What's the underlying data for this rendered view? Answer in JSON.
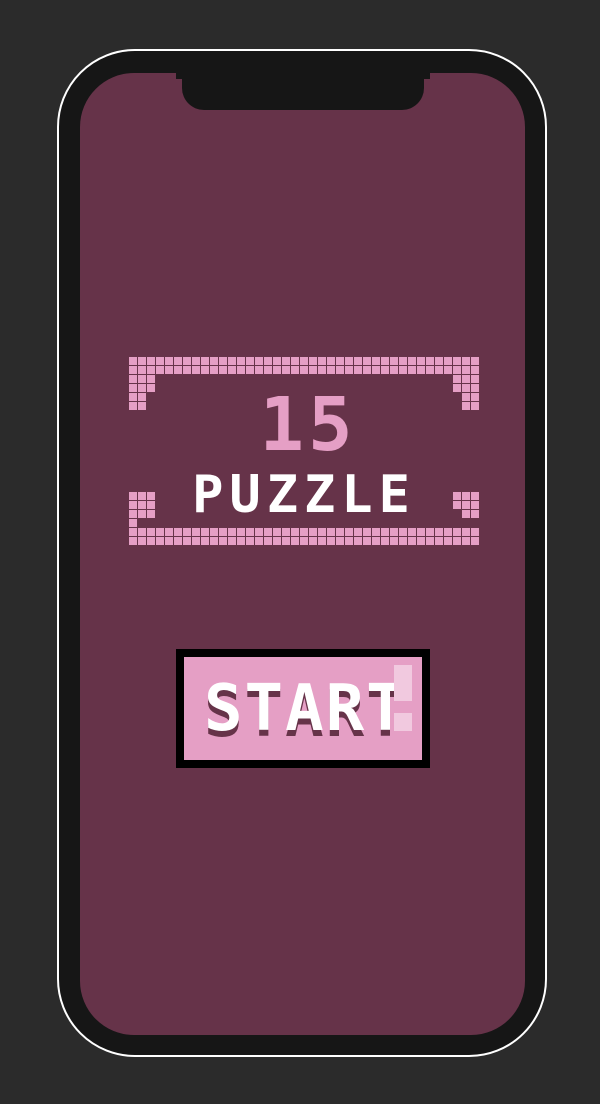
{
  "app": {
    "title_number": "15",
    "title_word": "PUZZLE"
  },
  "menu": {
    "start_label": "START"
  },
  "colors": {
    "background": "#2b2b2b",
    "screen": "#663349",
    "accent_pink": "#e59fc5",
    "text_white": "#ffffff",
    "button_border": "#000000"
  }
}
